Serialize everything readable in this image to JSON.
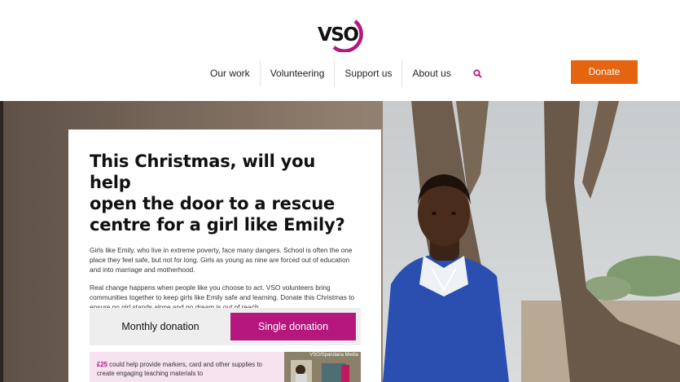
{
  "header": {
    "logo_text": "VSO",
    "nav": [
      "Our work",
      "Volunteering",
      "Support us",
      "About us"
    ],
    "search_icon": "search-icon",
    "donate_label": "Donate"
  },
  "colors": {
    "brand_magenta": "#b5177f",
    "donate_orange": "#e5640f"
  },
  "card": {
    "headline_lines": [
      "This Christmas, will you help",
      "open the door to a rescue",
      "centre for a girl like Emily?"
    ],
    "para1": "Girls like Emily, who live in extreme poverty, face many dangers. School is often the one place they feel safe, but not for long. Girls as young as nine are forced out of education and into marriage and motherhood.",
    "para2": "Real change happens when people like you choose to act. VSO volunteers bring communities together to keep girls like Emily safe and learning. Donate this Christmas to ensure no girl stands alone and no dream is out of reach.",
    "toggle": {
      "monthly": "Monthly donation",
      "single": "Single donation",
      "selected": "Single donation"
    },
    "impact": {
      "amount": "£25",
      "text": " could help provide markers, card and other supplies to create engaging teaching materials to",
      "image_credit": "VSO/Spandana Media"
    }
  }
}
